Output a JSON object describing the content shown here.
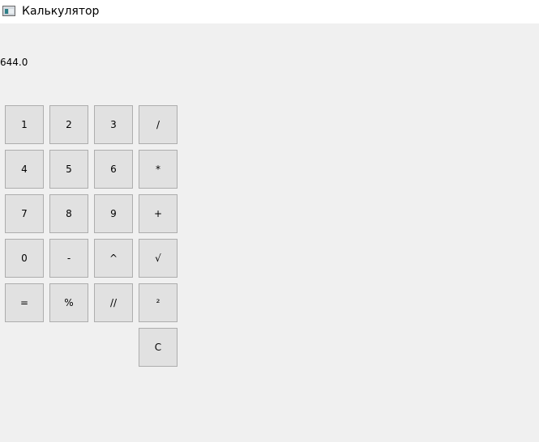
{
  "window": {
    "title": "Калькулятор",
    "icon": "calculator-window-icon"
  },
  "display": {
    "value": "644.0"
  },
  "keypad": {
    "row1": [
      "1",
      "2",
      "3",
      "/"
    ],
    "row2": [
      "4",
      "5",
      "6",
      "*"
    ],
    "row3": [
      "7",
      "8",
      "9",
      "+"
    ],
    "row4": [
      "0",
      "-",
      "^",
      "√"
    ],
    "row5": [
      "=",
      "%",
      "//",
      "²"
    ],
    "row6": [
      "C"
    ]
  }
}
